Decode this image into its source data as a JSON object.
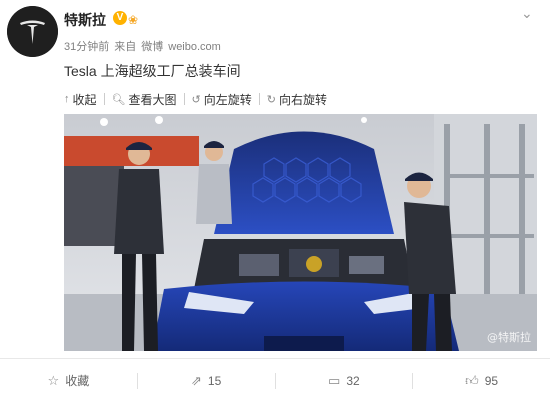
{
  "post": {
    "author": "特斯拉",
    "verified": "V",
    "time": "31分钟前",
    "source_prefix": "来自",
    "source_app": "微博",
    "source_site": "weibo.com",
    "text": "Tesla 上海超级工厂总装车间",
    "more_icon": "chevron-down-icon"
  },
  "toolbar": {
    "collapse": "收起",
    "view_large": "查看大图",
    "rotate_left": "向左旋转",
    "rotate_right": "向右旋转"
  },
  "photo": {
    "watermark": "@特斯拉"
  },
  "footer": {
    "favorite": "收藏",
    "repost_count": "15",
    "comment_count": "32",
    "like_count": "95"
  },
  "colors": {
    "brand_orange": "#ffb200",
    "car_blue": "#1d3fb0"
  }
}
